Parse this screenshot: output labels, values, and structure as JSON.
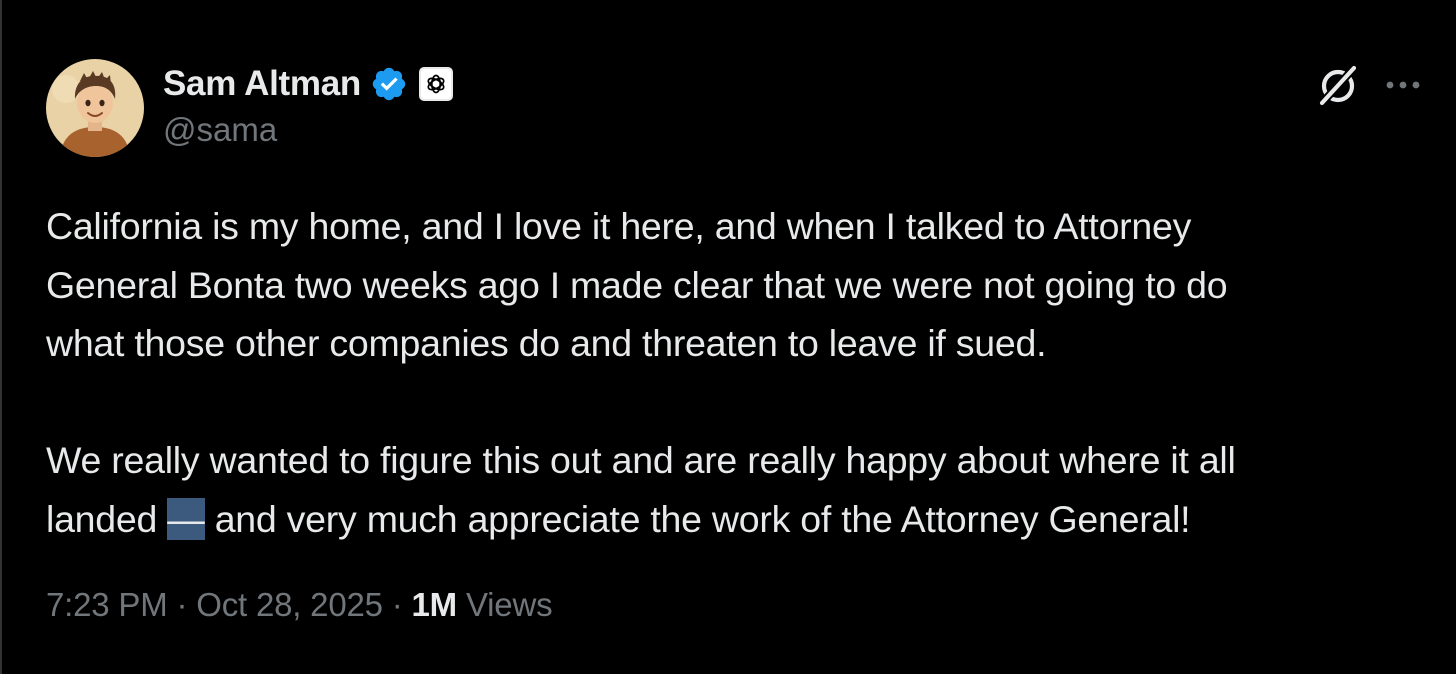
{
  "author": {
    "display_name": "Sam Altman",
    "handle": "@sama",
    "verified_icon": "verified-badge-icon",
    "affiliation_icon": "openai-logo-icon"
  },
  "header_actions": {
    "grok_icon": "grok-icon",
    "more_icon": "more-options-icon"
  },
  "tweet": {
    "paragraph_1": {
      "line_1": "California is my home, and I love it here, and when I talked to Attorney",
      "line_2": "General Bonta two weeks ago I made clear that we were not going to do",
      "line_3": "what those other companies do and threaten to leave if sued."
    },
    "paragraph_2": {
      "line_1": "We really wanted to figure this out and are really happy about where it all",
      "line_2_before": "landed ",
      "line_2_highlight": "—",
      "line_2_after": " and very much appreciate the work of the Attorney General!"
    }
  },
  "meta": {
    "time": "7:23 PM",
    "sep_1": " · ",
    "date": "Oct 28, 2025",
    "sep_2": " · ",
    "views_count": "1M",
    "views_label": " Views"
  },
  "colors": {
    "background": "#000000",
    "text_primary": "#e7e9ea",
    "text_secondary": "#71767b",
    "verified_blue": "#1d9bf0",
    "highlight": "#3b5a7e"
  }
}
